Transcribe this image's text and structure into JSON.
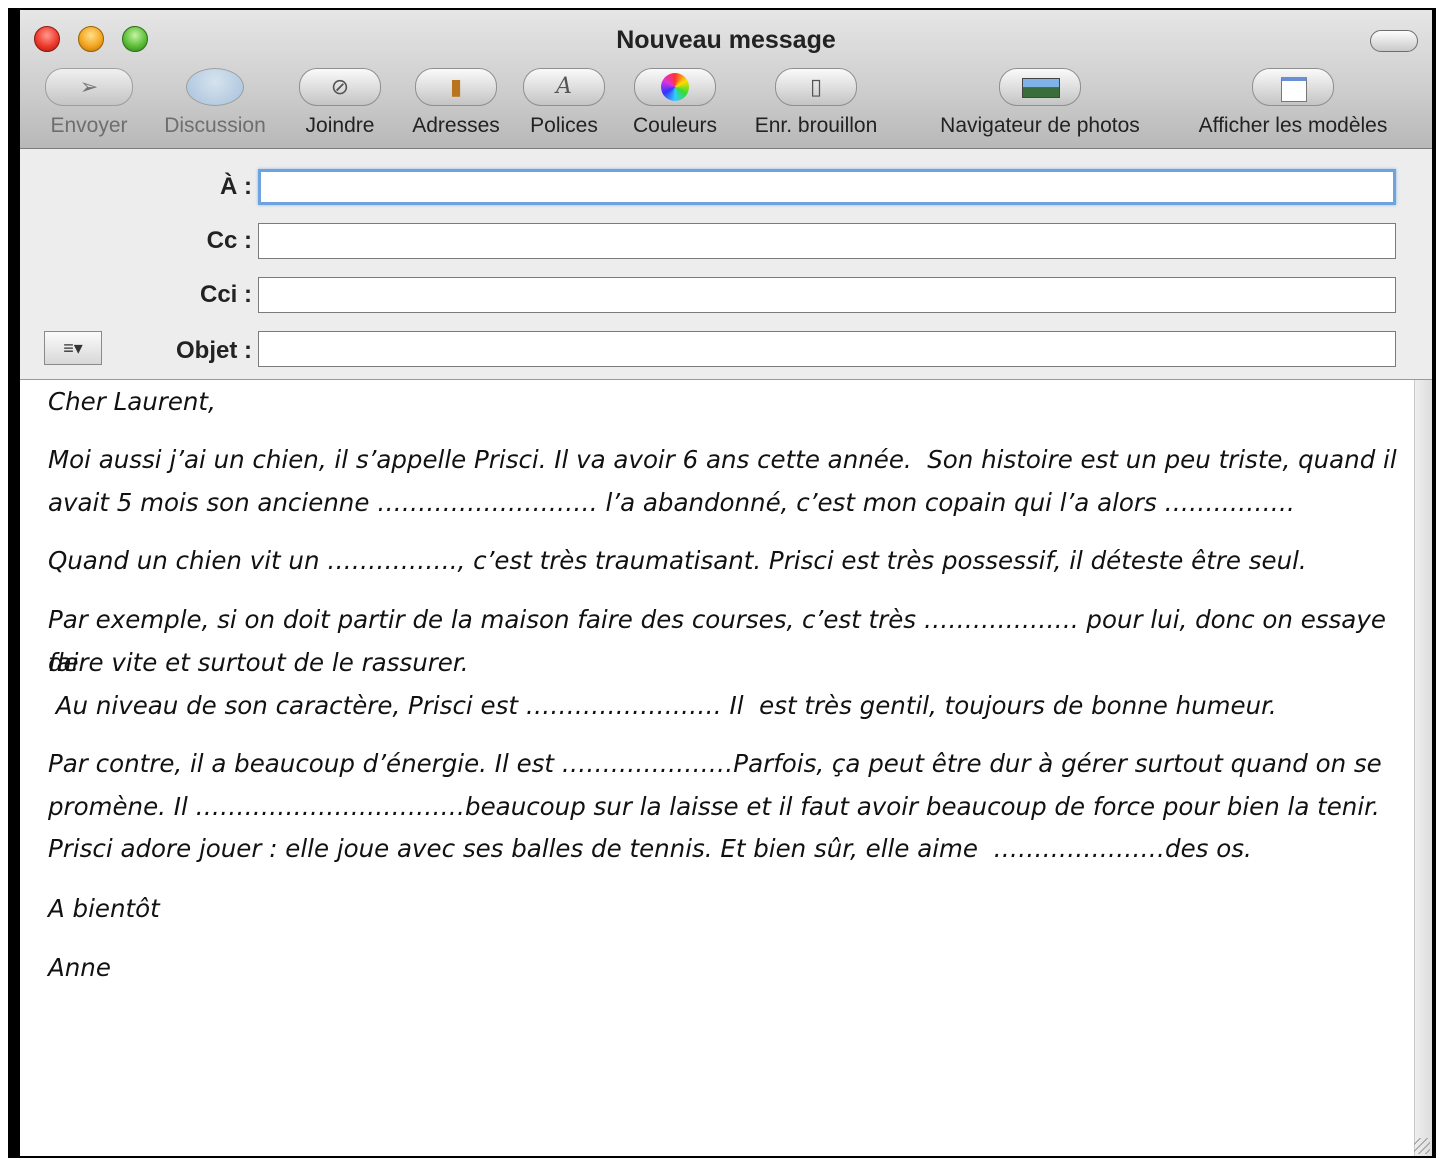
{
  "window": {
    "title": "Nouveau message"
  },
  "toolbar": {
    "send": "Envoyer",
    "chat": "Discussion",
    "attach": "Joindre",
    "addresses": "Adresses",
    "fonts": "Polices",
    "colors": "Couleurs",
    "save_draft": "Enr. brouillon",
    "photo_browser": "Navigateur de photos",
    "show_templates": "Afficher les modèles"
  },
  "fields": {
    "to_label": "À :",
    "cc_label": "Cc :",
    "bcc_label": "Cci :",
    "subject_label": "Objet :",
    "to_value": "",
    "cc_value": "",
    "bcc_value": "",
    "subject_value": ""
  },
  "message": {
    "greeting": "Cher Laurent,",
    "p1_line1": "Moi aussi j’ai un chien, il s’appelle Prisci. Il va avoir 6 ans cette année.  Son histoire est un peu triste, quand il",
    "p1_line2": "avait 5 mois son ancienne ……………………… l’a abandonné, c’est mon copain qui l’a alors …………….",
    "p2": "Quand un chien vit un ……………., c’est très traumatisant. Prisci est très possessif, il déteste être seul.",
    "p3_line1": "Par exemple, si on doit partir de la maison faire des courses, c’est très ………………. pour lui, donc on essaye de",
    "p3_line2": "faire vite et surtout de le rassurer.",
    "p3_line3": " Au niveau de son caractère, Prisci est …………………… Il  est très gentil, toujours de bonne humeur.",
    "p4_line1": "Par contre, il a beaucoup d’énergie. Il est …………………Parfois, ça peut être dur à gérer surtout quand on se",
    "p4_line2": "promène. Il ……………………………beaucoup sur la laisse et il faut avoir beaucoup de force pour bien la tenir.",
    "p4_line3": "Prisci adore jouer : elle joue avec ses balles de tennis. Et bien sûr, elle aime  …………………des os.",
    "closing": "A bientôt",
    "signature": "Anne"
  }
}
